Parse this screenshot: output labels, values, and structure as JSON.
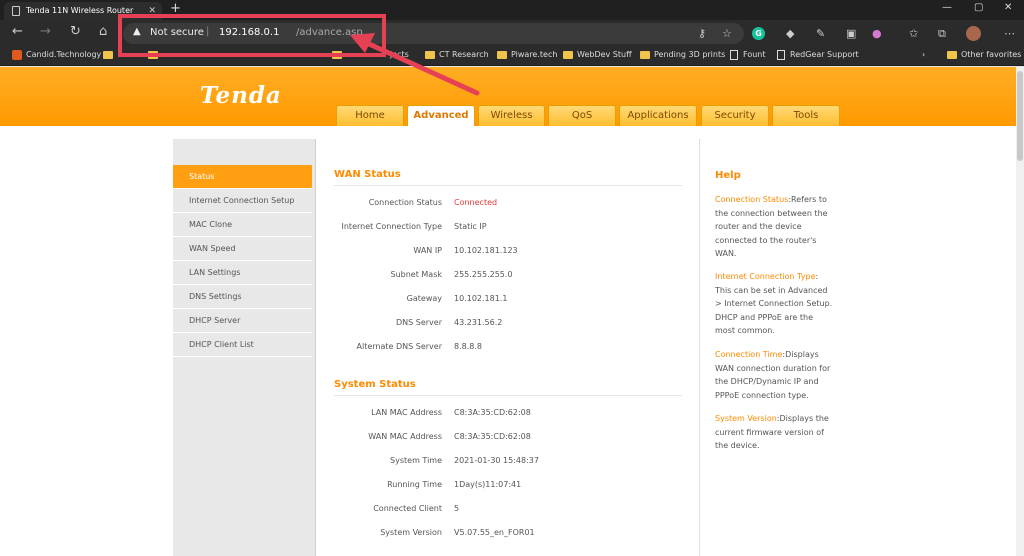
{
  "browser": {
    "tab_title": "Tenda 11N Wireless Router",
    "tab_close": "✕",
    "new_tab": "+",
    "security_label": "Not secure",
    "url_separator": "|",
    "url_host": "192.168.0.1",
    "url_path": "/advance.asp",
    "bookmarks": [
      {
        "label": "Candid.Technology",
        "icon": "site"
      },
      {
        "label": "CT Research",
        "icon": "folder"
      },
      {
        "label": "Piware.tech",
        "icon": "folder"
      },
      {
        "label": "WebDev Stuff",
        "icon": "folder"
      },
      {
        "label": "Pending 3D prints",
        "icon": "folder"
      },
      {
        "label": "Fount",
        "icon": "doc"
      },
      {
        "label": "RedGear Support",
        "icon": "doc"
      },
      {
        "label": "Other favorites",
        "icon": "folder"
      }
    ],
    "partial_bookmark_tail": "jects",
    "annotation_color": "#e64055"
  },
  "router": {
    "logo": "Tenda",
    "brand_color": "#ff9a00",
    "nav_tabs": [
      "Home",
      "Advanced",
      "Wireless",
      "QoS",
      "Applications",
      "Security",
      "Tools"
    ],
    "active_tab": "Advanced",
    "sidebar": [
      "Status",
      "Internet Connection Setup",
      "MAC Clone",
      "WAN Speed",
      "LAN Settings",
      "DNS Settings",
      "DHCP Server",
      "DHCP Client List"
    ],
    "active_sidebar": "Status",
    "wan_title": "WAN Status",
    "wan_rows": [
      {
        "label": "Connection Status",
        "value": "Connected"
      },
      {
        "label": "Internet Connection Type",
        "value": "Static IP"
      },
      {
        "label": "WAN IP",
        "value": "10.102.181.123"
      },
      {
        "label": "Subnet Mask",
        "value": "255.255.255.0"
      },
      {
        "label": "Gateway",
        "value": "10.102.181.1"
      },
      {
        "label": "DNS Server",
        "value": "43.231.56.2"
      },
      {
        "label": "Alternate DNS Server",
        "value": "8.8.8.8"
      }
    ],
    "system_title": "System Status",
    "system_rows": [
      {
        "label": "LAN MAC Address",
        "value": "C8:3A:35:CD:62:08"
      },
      {
        "label": "WAN MAC Address",
        "value": "C8:3A:35:CD:62:08"
      },
      {
        "label": "System Time",
        "value": "2021-01-30 15:48:37"
      },
      {
        "label": "Running Time",
        "value": "1Day(s)11:07:41"
      },
      {
        "label": "Connected Client",
        "value": "5"
      },
      {
        "label": "System Version",
        "value": "V5.07.55_en_FOR01"
      }
    ],
    "help_title": "Help",
    "help": [
      {
        "term": "Connection Status",
        "text": ":Refers to the connection between the router and the device connected to the router's WAN."
      },
      {
        "term": "Internet Connection Type",
        "text": ": This can be set in Advanced > Internet Connection Setup. DHCP and PPPoE are the most common."
      },
      {
        "term": "Connection Time",
        "text": ":Displays WAN connection duration for the DHCP/Dynamic IP and PPPoE connection type."
      },
      {
        "term": "System Version",
        "text": ":Displays the current firmware version of the device."
      }
    ]
  }
}
